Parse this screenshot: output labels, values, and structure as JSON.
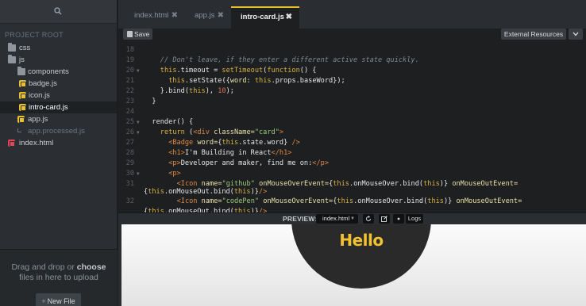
{
  "sidebar": {
    "project_root": "PROJECT ROOT",
    "tree": [
      {
        "name": "css",
        "type": "folder",
        "indent": 0
      },
      {
        "name": "js",
        "type": "folder",
        "indent": 0
      },
      {
        "name": "components",
        "type": "folder",
        "indent": 1
      },
      {
        "name": "badge.js",
        "type": "js",
        "indent": 2
      },
      {
        "name": "icon.js",
        "type": "js",
        "indent": 2
      },
      {
        "name": "intro-card.js",
        "type": "js",
        "indent": 2,
        "active": true
      },
      {
        "name": "app.js",
        "type": "js",
        "indent": 1
      },
      {
        "name": "app.processed.js",
        "type": "link",
        "indent": 1
      },
      {
        "name": "index.html",
        "type": "html",
        "indent": 0
      }
    ],
    "drop_text_pre": "Drag and drop or ",
    "drop_text_bold": "choose",
    "drop_text_post": " files in here to upload",
    "new_file_plus": "+",
    "new_file_label": "New File"
  },
  "tabs": [
    {
      "label": "index.html",
      "close": "✖"
    },
    {
      "label": "app.js",
      "close": "✖"
    },
    {
      "label": "intro-card.js",
      "close": "✖",
      "active": true
    }
  ],
  "toolbar": {
    "save_label": "Save",
    "external_resources_label": "External Resources"
  },
  "editor": {
    "lines": [
      {
        "n": "18",
        "fold": false,
        "indent": 0,
        "tokens": []
      },
      {
        "n": "19",
        "fold": false,
        "indent": 2,
        "tokens": [
          [
            "cm",
            "// Don't leave, if they enter a different active state quickly."
          ]
        ]
      },
      {
        "n": "20",
        "fold": true,
        "indent": 2,
        "tokens": [
          [
            "kw",
            "this"
          ],
          [
            "tx",
            ".timeout = "
          ],
          [
            "kw",
            "setTimeout"
          ],
          [
            "tx",
            "("
          ],
          [
            "kw",
            "function"
          ],
          [
            "tx",
            "() {"
          ]
        ]
      },
      {
        "n": "21",
        "fold": false,
        "indent": 3,
        "tokens": [
          [
            "kw",
            "this"
          ],
          [
            "tx",
            ".setState({"
          ],
          [
            "at",
            "word"
          ],
          [
            "tx",
            ": "
          ],
          [
            "kw",
            "this"
          ],
          [
            "tx",
            ".props.baseWord});"
          ]
        ]
      },
      {
        "n": "22",
        "fold": false,
        "indent": 2,
        "tokens": [
          [
            "tx",
            "}.bind("
          ],
          [
            "kw",
            "this"
          ],
          [
            "tx",
            "), "
          ],
          [
            "num",
            "10"
          ],
          [
            "tx",
            ");"
          ]
        ]
      },
      {
        "n": "23",
        "fold": false,
        "indent": 1,
        "tokens": [
          [
            "tx",
            "}"
          ]
        ]
      },
      {
        "n": "24",
        "fold": false,
        "indent": 0,
        "tokens": []
      },
      {
        "n": "25",
        "fold": true,
        "indent": 1,
        "tokens": [
          [
            "tx",
            "render() {"
          ]
        ]
      },
      {
        "n": "26",
        "fold": true,
        "indent": 2,
        "tokens": [
          [
            "kw",
            "return"
          ],
          [
            "tx",
            " ("
          ],
          [
            "tag",
            "<div"
          ],
          [
            "at",
            " className="
          ],
          [
            "str",
            "\"card\""
          ],
          [
            "tag",
            ">"
          ]
        ]
      },
      {
        "n": "27",
        "fold": false,
        "indent": 3,
        "tokens": [
          [
            "tag",
            "<Badge"
          ],
          [
            "at",
            " word="
          ],
          [
            "tx",
            "{"
          ],
          [
            "kw",
            "this"
          ],
          [
            "tx",
            ".state.word}"
          ],
          [
            "tag",
            " />"
          ]
        ]
      },
      {
        "n": "28",
        "fold": false,
        "indent": 3,
        "tokens": [
          [
            "tag",
            "<h1>"
          ],
          [
            "tx",
            "I'm Building in React"
          ],
          [
            "tag",
            "</h1>"
          ]
        ]
      },
      {
        "n": "29",
        "fold": false,
        "indent": 3,
        "tokens": [
          [
            "tag",
            "<p>"
          ],
          [
            "tx",
            "Developer and maker, find me on:"
          ],
          [
            "tag",
            "</p>"
          ]
        ]
      },
      {
        "n": "30",
        "fold": true,
        "indent": 3,
        "tokens": [
          [
            "tag",
            "<p>"
          ]
        ]
      },
      {
        "n": "31",
        "fold": false,
        "indent": 4,
        "tokens": [
          [
            "tag",
            "<Icon"
          ],
          [
            "at",
            " name="
          ],
          [
            "str",
            "\"github\""
          ],
          [
            "at",
            " onMouseOverEvent="
          ],
          [
            "tx",
            "{"
          ],
          [
            "kw",
            "this"
          ],
          [
            "tx",
            ".onMouseOver.bind("
          ],
          [
            "kw",
            "this"
          ],
          [
            "tx",
            ")}"
          ],
          [
            "at",
            " onMouseOutEvent="
          ]
        ]
      },
      {
        "n": "",
        "fold": false,
        "indent": -1,
        "tokens": [
          [
            "tx",
            "{"
          ],
          [
            "kw",
            "this"
          ],
          [
            "tx",
            ".onMouseOut.bind("
          ],
          [
            "kw",
            "this"
          ],
          [
            "tx",
            ")}"
          ],
          [
            "tag",
            "/>"
          ]
        ]
      },
      {
        "n": "32",
        "fold": false,
        "indent": 4,
        "tokens": [
          [
            "tag",
            "<Icon"
          ],
          [
            "at",
            " name="
          ],
          [
            "str",
            "\"codePen\""
          ],
          [
            "at",
            " onMouseOverEvent="
          ],
          [
            "tx",
            "{"
          ],
          [
            "kw",
            "this"
          ],
          [
            "tx",
            ".onMouseOver.bind("
          ],
          [
            "kw",
            "this"
          ],
          [
            "tx",
            ")}"
          ],
          [
            "at",
            " onMouseOutEvent="
          ]
        ]
      },
      {
        "n": "",
        "fold": false,
        "indent": -1,
        "tokens": [
          [
            "tx",
            "{"
          ],
          [
            "kw",
            "this"
          ],
          [
            "tx",
            ".onMouseOut.bind("
          ],
          [
            "kw",
            "this"
          ],
          [
            "tx",
            ")}"
          ],
          [
            "tag",
            "/>"
          ]
        ]
      }
    ]
  },
  "preview_bar": {
    "label": "PREVIEW:",
    "selected_file": "index.html",
    "logs_label": "Logs"
  },
  "preview": {
    "hello": "Hello"
  },
  "colors": {
    "accent": "#e8c12c",
    "html_icon": "#e1465a",
    "hello_text": "#f2c230"
  }
}
